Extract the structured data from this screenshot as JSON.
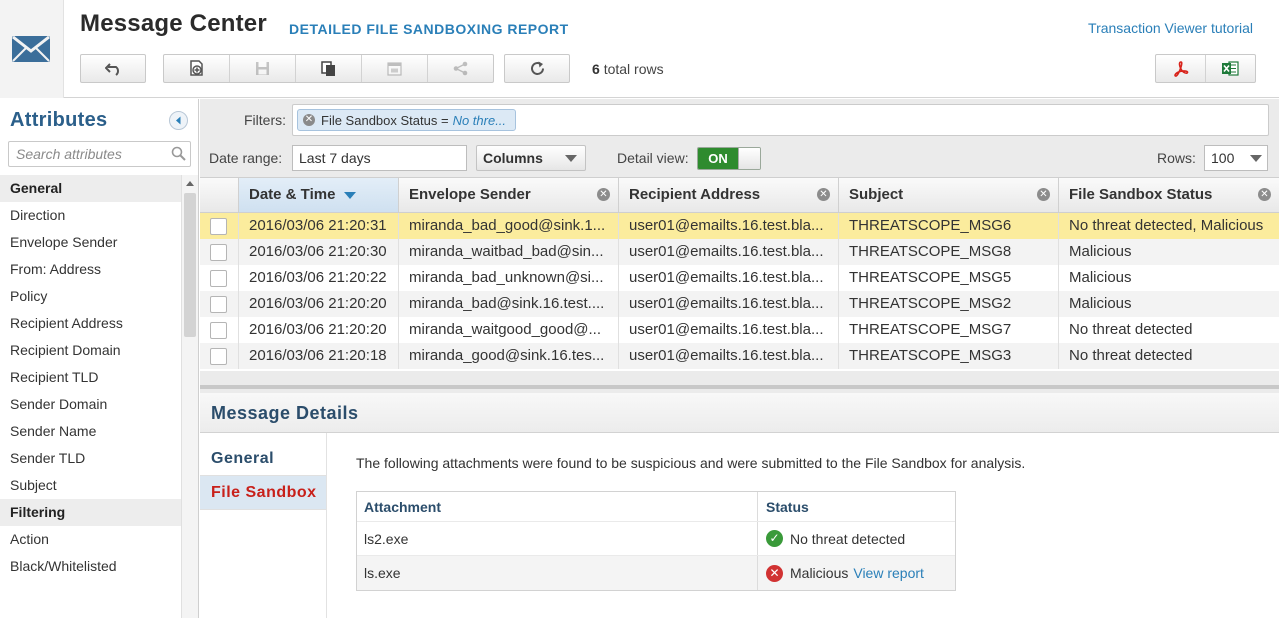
{
  "header": {
    "title": "Message Center",
    "subtitle": "DETAILED FILE SANDBOXING REPORT",
    "tutorial_link": "Transaction Viewer tutorial",
    "total_rows_count": "6",
    "total_rows_label": "total rows",
    "toolbar_icons": [
      "undo-icon",
      "add-icon",
      "save-icon",
      "copy-icon",
      "calendar-icon",
      "share-icon",
      "refresh-icon",
      "pdf-icon",
      "excel-icon"
    ]
  },
  "sidebar": {
    "title": "Attributes",
    "search_placeholder": "Search attributes",
    "items": [
      {
        "label": "General",
        "group": true
      },
      {
        "label": "Direction"
      },
      {
        "label": "Envelope Sender"
      },
      {
        "label": "From: Address"
      },
      {
        "label": "Policy"
      },
      {
        "label": "Recipient Address"
      },
      {
        "label": "Recipient Domain"
      },
      {
        "label": "Recipient TLD"
      },
      {
        "label": "Sender Domain"
      },
      {
        "label": "Sender Name"
      },
      {
        "label": "Sender TLD"
      },
      {
        "label": "Subject"
      },
      {
        "label": "Filtering",
        "group": true
      },
      {
        "label": "Action"
      },
      {
        "label": "Black/Whitelisted"
      }
    ]
  },
  "filters": {
    "label": "Filters:",
    "chip_field": "File Sandbox Status =",
    "chip_value": "No thre..."
  },
  "controls": {
    "date_range_label": "Date range:",
    "date_range_value": "Last 7 days",
    "columns_label": "Columns",
    "detail_view_label": "Detail view:",
    "detail_view_state": "ON",
    "rows_label": "Rows:",
    "rows_value": "100"
  },
  "grid": {
    "columns": [
      "Date & Time",
      "Envelope Sender",
      "Recipient Address",
      "Subject",
      "File Sandbox Status"
    ],
    "rows": [
      {
        "date": "2016/03/06 21:20:31",
        "sender": "miranda_bad_good@sink.1...",
        "recipient": "user01@emailts.16.test.bla...",
        "subject": "THREATSCOPE_MSG6",
        "status": "No threat detected, Malicious"
      },
      {
        "date": "2016/03/06 21:20:30",
        "sender": "miranda_waitbad_bad@sin...",
        "recipient": "user01@emailts.16.test.bla...",
        "subject": "THREATSCOPE_MSG8",
        "status": "Malicious"
      },
      {
        "date": "2016/03/06 21:20:22",
        "sender": "miranda_bad_unknown@si...",
        "recipient": "user01@emailts.16.test.bla...",
        "subject": "THREATSCOPE_MSG5",
        "status": "Malicious"
      },
      {
        "date": "2016/03/06 21:20:20",
        "sender": "miranda_bad@sink.16.test....",
        "recipient": "user01@emailts.16.test.bla...",
        "subject": "THREATSCOPE_MSG2",
        "status": "Malicious"
      },
      {
        "date": "2016/03/06 21:20:20",
        "sender": "miranda_waitgood_good@...",
        "recipient": "user01@emailts.16.test.bla...",
        "subject": "THREATSCOPE_MSG7",
        "status": "No threat detected"
      },
      {
        "date": "2016/03/06 21:20:18",
        "sender": "miranda_good@sink.16.tes...",
        "recipient": "user01@emailts.16.test.bla...",
        "subject": "THREATSCOPE_MSG3",
        "status": "No threat detected"
      }
    ]
  },
  "details": {
    "title": "Message Details",
    "tabs": [
      {
        "label": "General",
        "active": false
      },
      {
        "label": "File Sandbox",
        "active": true
      }
    ],
    "intro": "The following attachments were found to be suspicious and were submitted to the File Sandbox for analysis.",
    "table_headers": [
      "Attachment",
      "Status"
    ],
    "attachments": [
      {
        "name": "ls2.exe",
        "status": "No threat detected",
        "status_icon": "check-icon"
      },
      {
        "name": "ls.exe",
        "status": "Malicious",
        "status_icon": "error-icon",
        "link": "View report"
      }
    ]
  },
  "colors": {
    "accent_blue": "#2a7fb8",
    "selected_row": "#fbec9d",
    "toggle_on": "#2e8b2e",
    "active_tab_text": "#c8201a",
    "malicious_icon": "#d13232",
    "ok_icon": "#3a9a3a"
  }
}
